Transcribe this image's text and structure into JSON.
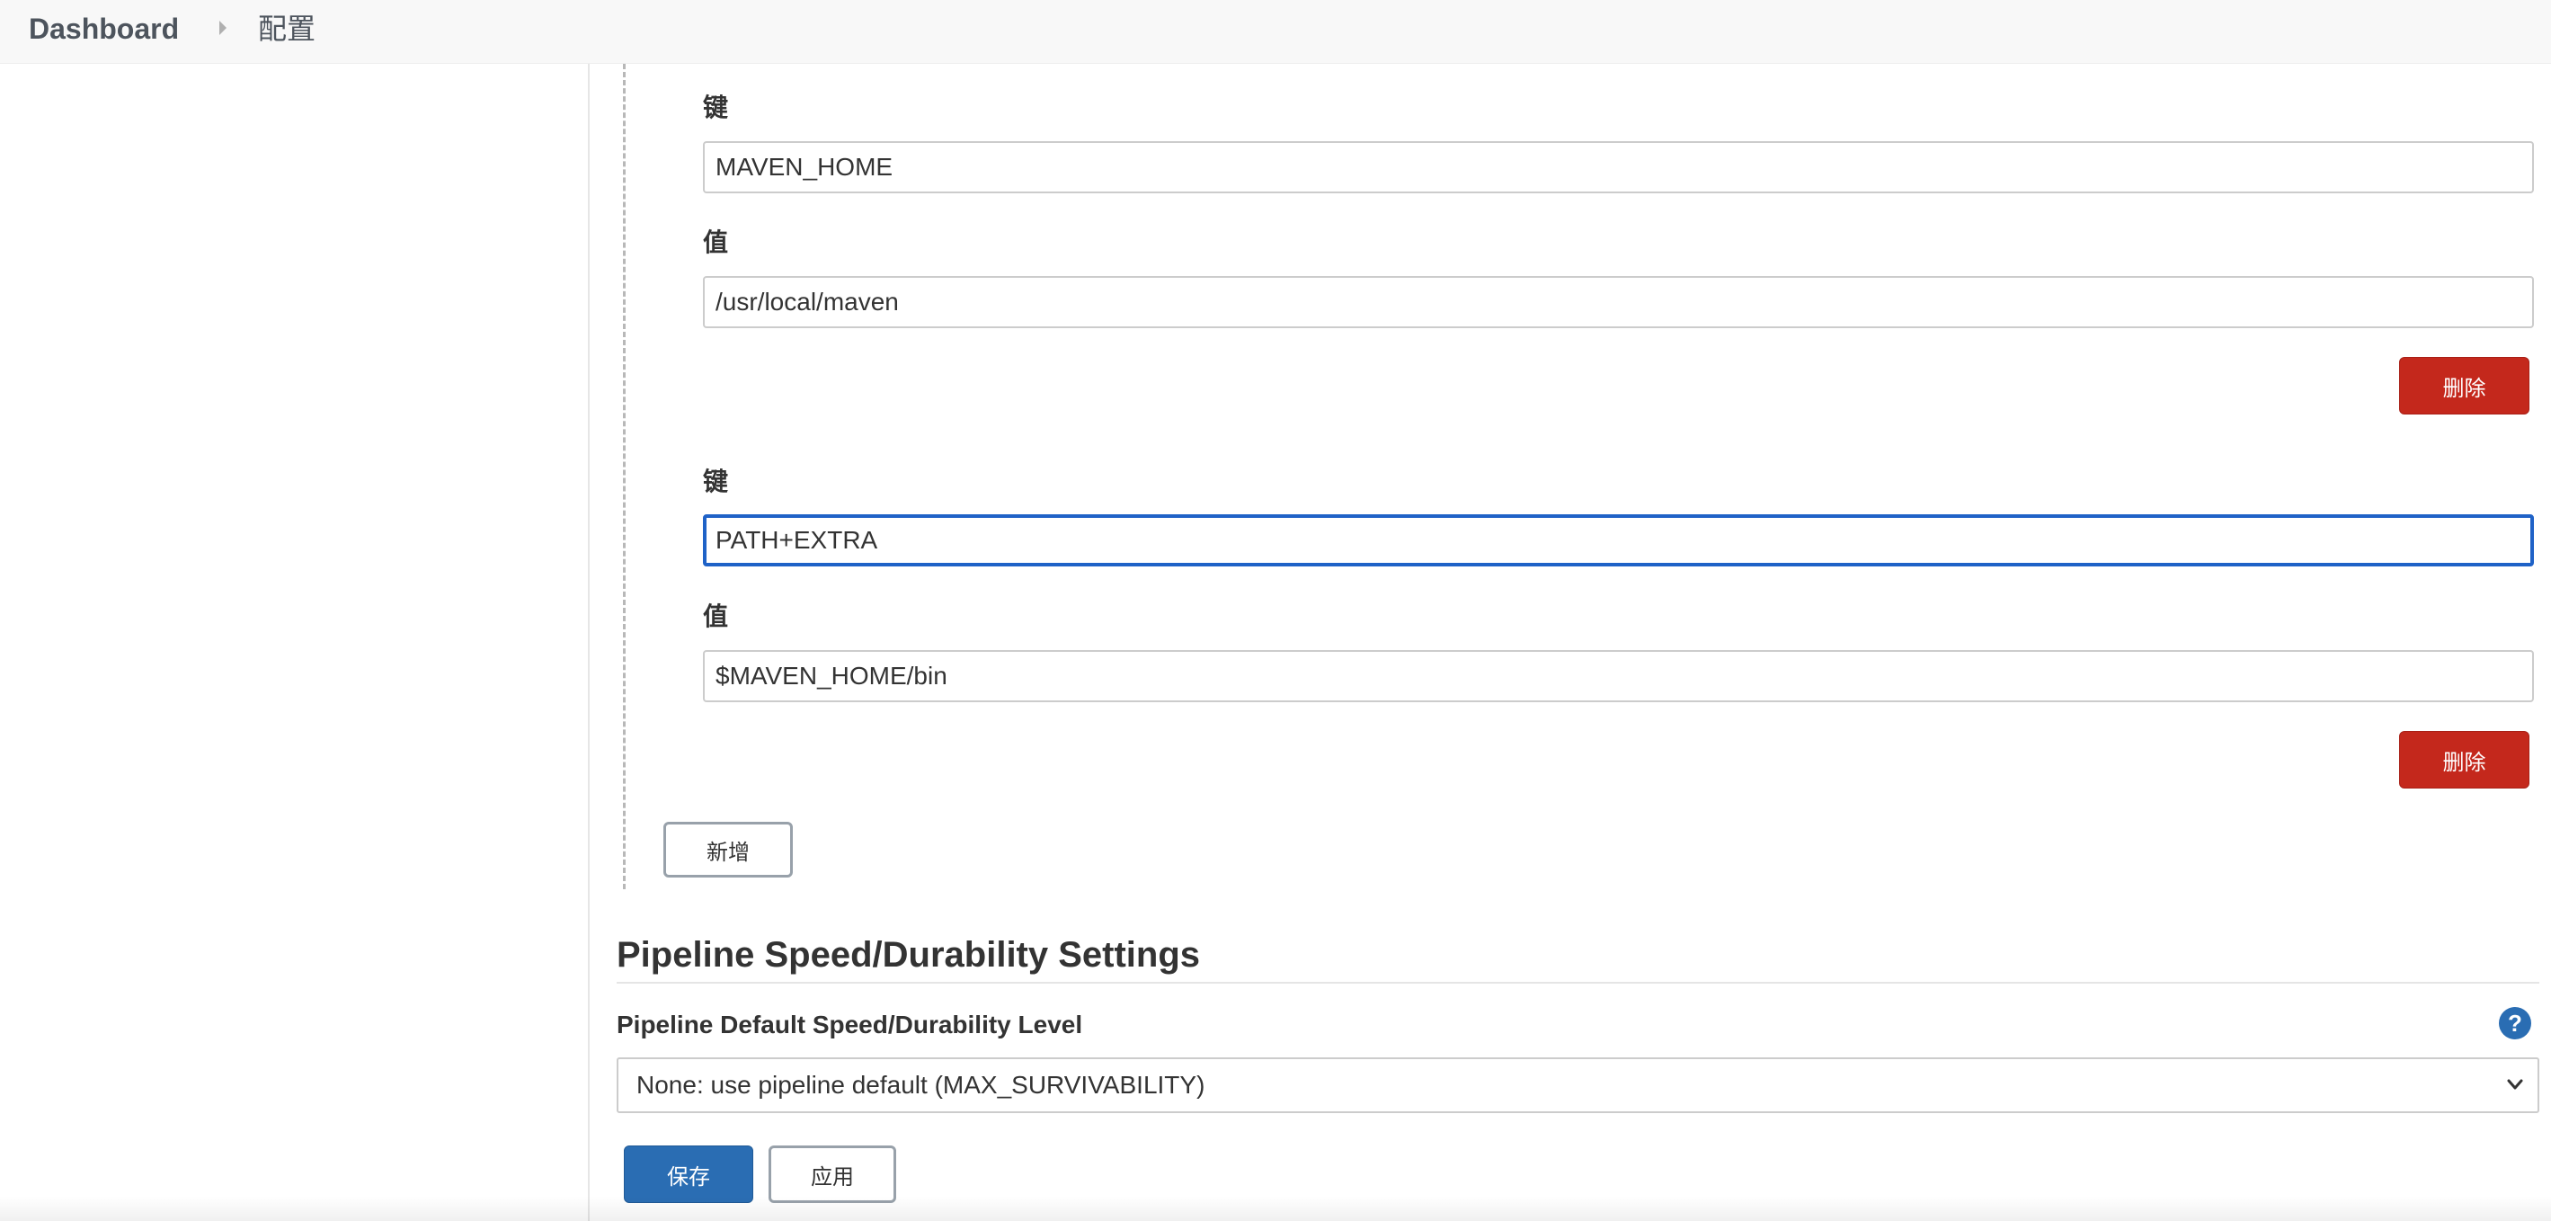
{
  "breadcrumb": {
    "home": "Dashboard",
    "current": "配置"
  },
  "env_vars": [
    {
      "key_label": "键",
      "key_value": "MAVEN_HOME",
      "value_label": "值",
      "value_value": "/usr/local/maven",
      "delete_label": "删除"
    },
    {
      "key_label": "键",
      "key_value": "PATH+EXTRA",
      "value_label": "值",
      "value_value": "$MAVEN_HOME/bin",
      "delete_label": "删除"
    }
  ],
  "add_label": "新增",
  "pipeline": {
    "section_title": "Pipeline Speed/Durability Settings",
    "setting_label": "Pipeline Default Speed/Durability Level",
    "help_symbol": "?",
    "selected_option": "None: use pipeline default (MAX_SURVIVABILITY)"
  },
  "actions": {
    "save_label": "保存",
    "apply_label": "应用"
  },
  "colors": {
    "accent_blue": "#2a6db3",
    "danger_red": "#c4281c",
    "focus_blue": "#1f62c7"
  }
}
